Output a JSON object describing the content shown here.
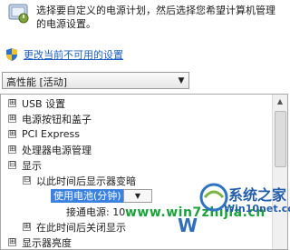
{
  "header": {
    "description": "选择要自定义的电源计划，然后选择您希望计算机管理的电源设置。"
  },
  "link_unavailable": "更改当前不可用的设置",
  "plan_select": {
    "value": "高性能 [活动]"
  },
  "tree": {
    "items": [
      {
        "expander": "⊞",
        "label": "USB 设置"
      },
      {
        "expander": "⊞",
        "label": "电源按钮和盖子"
      },
      {
        "expander": "⊞",
        "label": "PCI Express"
      },
      {
        "expander": "⊞",
        "label": "处理器电源管理"
      },
      {
        "expander": "⊟",
        "label": "显示"
      },
      {
        "expander": "⊟",
        "label": "以此时间后显示器变暗"
      },
      {
        "label": "使用电池(分钟)"
      },
      {
        "label": "接通电源: 10"
      },
      {
        "expander": "⊞",
        "label": "在此时间后关闭显示"
      },
      {
        "expander": "⊞",
        "label": "显示器亮度"
      }
    ]
  },
  "watermarks": {
    "site": "www.win7zhijia.cn",
    "brand": "系统之家",
    "url": "Win10net.com",
    "mark": "W"
  }
}
